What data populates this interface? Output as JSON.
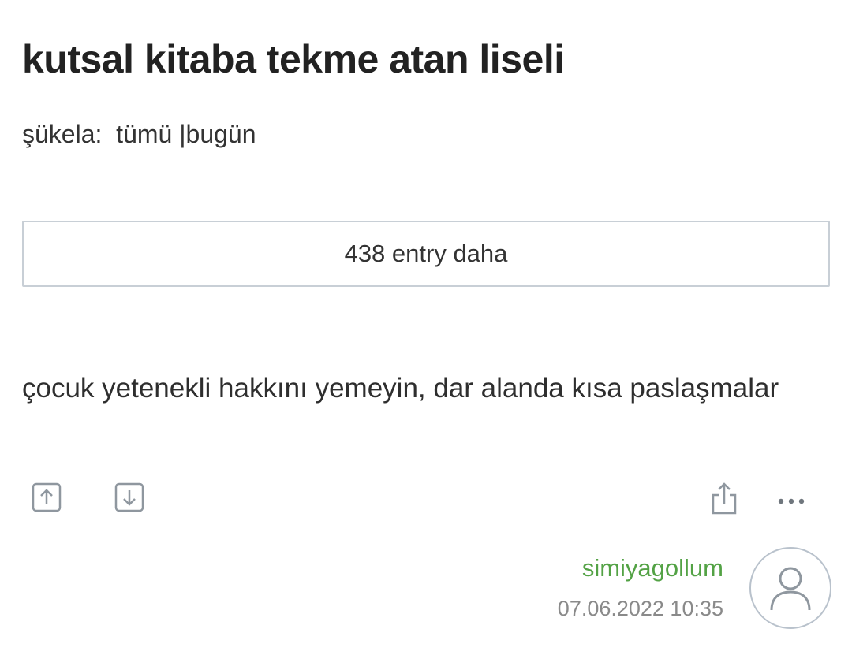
{
  "topic": {
    "title": "kutsal kitaba tekme atan liseli"
  },
  "filter": {
    "label": "şükela:",
    "option_all": "tümü",
    "separator": "|",
    "option_today": "bugün"
  },
  "more_entries": {
    "label": "438 entry daha"
  },
  "entry": {
    "text": "çocuk yetenekli hakkını yemeyin, dar alanda kısa paslaşmalar",
    "author": "simiyagollum",
    "datetime": "07.06.2022 10:35",
    "actions": {
      "upvote_icon": "arrow-up-box-icon",
      "downvote_icon": "arrow-down-box-icon",
      "share_icon": "share-icon",
      "more_icon": "ellipsis-icon"
    }
  },
  "colors": {
    "author": "#53a245",
    "date": "#8a8a8a",
    "border": "#c8cfd6",
    "icon": "#8f979f"
  }
}
